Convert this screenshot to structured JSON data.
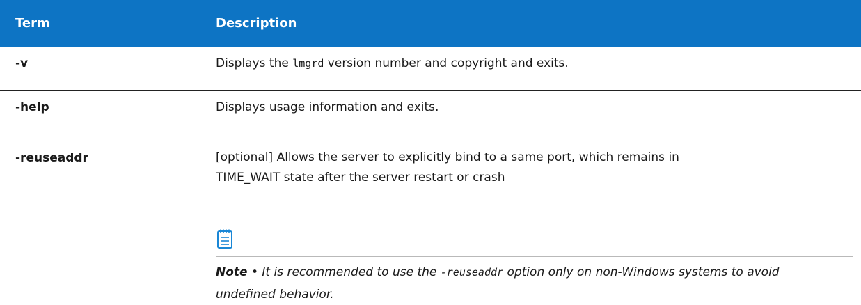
{
  "header": {
    "term": "Term",
    "description": "Description"
  },
  "rows": [
    {
      "term": "-v",
      "desc_before": "Displays the ",
      "desc_code": "lmgrd",
      "desc_after": " version number and copyright and exits."
    },
    {
      "term": "-help",
      "description": "Displays usage information and exits."
    },
    {
      "term": "-reuseaddr",
      "description_line1": "[optional] Allows the server to explicitly bind to a same port, which remains in",
      "description_line2": "TIME_WAIT state after the server restart or crash",
      "note": {
        "icon": "note-icon",
        "label": "Note",
        "bullet": " • ",
        "text_before": "It is recommended to use the ",
        "code": "-reuseaddr",
        "text_after": " option only on non-Windows systems to avoid undefined behavior."
      }
    }
  ],
  "colors": {
    "header_bg": "#0d74c4",
    "icon_blue": "#1a87d6"
  }
}
